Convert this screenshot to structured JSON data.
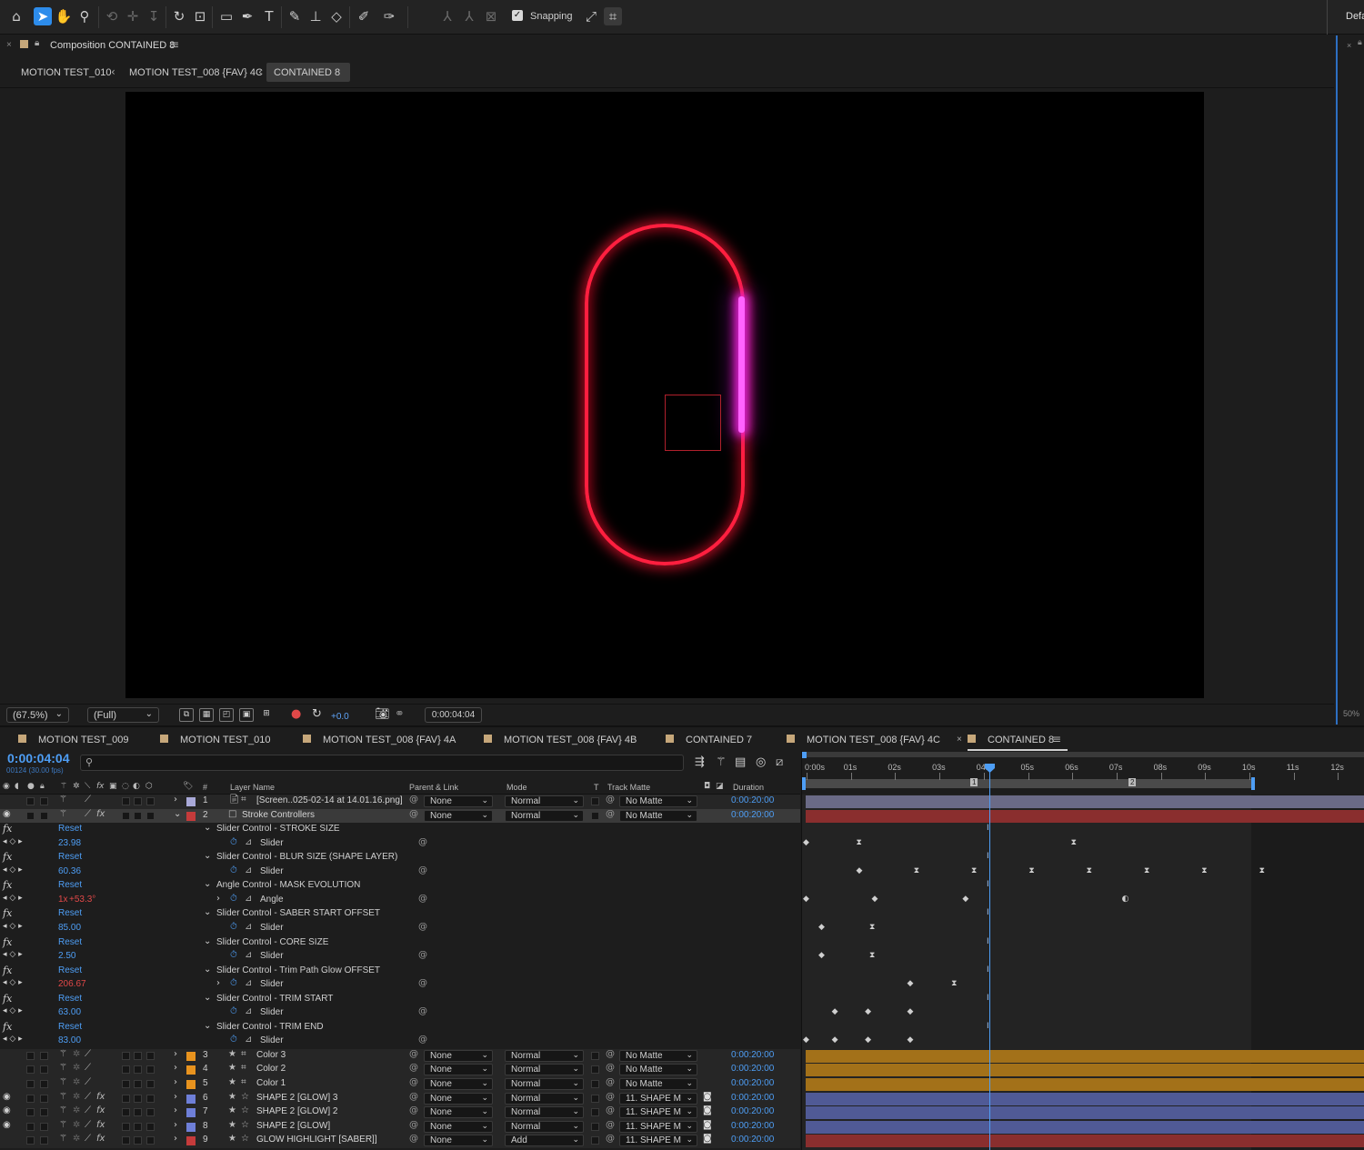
{
  "colors": {
    "accent_blue": "#4e9ef5",
    "label_gray": "#a9a9d8",
    "label_red": "#c53b3b",
    "label_orange": "#e8931e",
    "label_blue": "#6e7fd8",
    "bar_gray": "#6a6a86",
    "bar_red": "#8a2e2e",
    "bar_orange": "#a37119",
    "bar_blue": "#505a96",
    "stroke_red": "#ff1f3f",
    "saber_magenta": "#ff63ff"
  },
  "toolbar": {
    "tools": [
      "home-icon",
      "selection-tool-icon",
      "hand-tool-icon",
      "zoom-tool-icon",
      "orbit-camera-icon",
      "pan-camera-icon",
      "dolly-camera-icon",
      "rotate-tool-icon",
      "pan-behind-tool-icon",
      "rectangle-tool-icon",
      "pen-tool-icon",
      "type-tool-icon",
      "brush-tool-icon",
      "clone-stamp-tool-icon",
      "eraser-tool-icon",
      "roto-brush-tool-icon",
      "puppet-pin-tool-icon"
    ],
    "snapping_label": "Snapping",
    "snapping_checked": true,
    "workspace_label": "Defa"
  },
  "composition": {
    "title": "Composition CONTAINED 8",
    "breadcrumbs": [
      "MOTION TEST_010",
      "MOTION TEST_008 {FAV} 4C",
      "CONTAINED 8"
    ],
    "zoom": "(67.5%)",
    "resolution": "(Full)",
    "exposure": "+0.0",
    "timecode": "0:00:04:04"
  },
  "right_panel": {
    "zoom": "50%"
  },
  "timeline": {
    "tabs": [
      "MOTION TEST_009",
      "MOTION TEST_010",
      "MOTION TEST_008 {FAV} 4A",
      "MOTION TEST_008 {FAV} 4B",
      "CONTAINED 7",
      "MOTION TEST_008 {FAV} 4C",
      "CONTAINED 8"
    ],
    "active_tab": "CONTAINED 8",
    "timecode": "0:00:04:04",
    "frame_info": "00124 (30.00 fps)",
    "search_placeholder": "",
    "columns": {
      "number": "#",
      "layer_name": "Layer Name",
      "parent": "Parent & Link",
      "mode": "Mode",
      "t": "T",
      "track_matte": "Track Matte",
      "duration": "Duration"
    },
    "ruler_labels": [
      "0:00s",
      "01s",
      "02s",
      "03s",
      "04s",
      "05s",
      "06s",
      "07s",
      "08s",
      "09s",
      "10s",
      "11s",
      "12s"
    ],
    "marker_labels": [
      "1",
      "2"
    ],
    "layers_top": [
      {
        "num": "1",
        "name": "[Screen..025-02-14 at 14.01.16.png]",
        "parent": "None",
        "mode": "Normal",
        "matte": "No Matte",
        "duration": "0:00:20:00"
      },
      {
        "num": "2",
        "name": "Stroke Controllers",
        "parent": "None",
        "mode": "Normal",
        "matte": "No Matte",
        "duration": "0:00:20:00"
      }
    ],
    "effects": [
      {
        "name": "Slider Control - STROKE SIZE",
        "reset": "Reset",
        "value": "23.98",
        "prop": "Slider"
      },
      {
        "name": "Slider Control - BLUR SIZE (SHAPE LAYER)",
        "reset": "Reset",
        "value": "60.36",
        "prop": "Slider"
      },
      {
        "name": "Angle Control - MASK EVOLUTION",
        "reset": "Reset",
        "value_rev": "1x",
        "value": "+53.3°",
        "prop": "Angle"
      },
      {
        "name": "Slider Control - SABER START OFFSET",
        "reset": "Reset",
        "value": "85.00",
        "prop": "Slider"
      },
      {
        "name": "Slider Control - CORE SIZE",
        "reset": "Reset",
        "value": "2.50",
        "prop": "Slider"
      },
      {
        "name": "Slider Control - Trim Path Glow OFFSET",
        "reset": "Reset",
        "value": "206.67",
        "prop": "Slider"
      },
      {
        "name": "Slider Control - TRIM START",
        "reset": "Reset",
        "value": "63.00",
        "prop": "Slider"
      },
      {
        "name": "Slider Control - TRIM END",
        "reset": "Reset",
        "value": "83.00",
        "prop": "Slider"
      }
    ],
    "layers_bottom": [
      {
        "num": "3",
        "name": "Color 3",
        "parent": "None",
        "mode": "Normal",
        "matte": "No Matte",
        "duration": "0:00:20:00"
      },
      {
        "num": "4",
        "name": "Color 2",
        "parent": "None",
        "mode": "Normal",
        "matte": "No Matte",
        "duration": "0:00:20:00"
      },
      {
        "num": "5",
        "name": "Color 1",
        "parent": "None",
        "mode": "Normal",
        "matte": "No Matte",
        "duration": "0:00:20:00"
      },
      {
        "num": "6",
        "name": "SHAPE 2 [GLOW] 3",
        "parent": "None",
        "mode": "Normal",
        "matte": "11. SHAPE  M",
        "duration": "0:00:20:00"
      },
      {
        "num": "7",
        "name": "SHAPE 2 [GLOW] 2",
        "parent": "None",
        "mode": "Normal",
        "matte": "11. SHAPE  M",
        "duration": "0:00:20:00"
      },
      {
        "num": "8",
        "name": "SHAPE 2 [GLOW]",
        "parent": "None",
        "mode": "Normal",
        "matte": "11. SHAPE  M",
        "duration": "0:00:20:00"
      },
      {
        "num": "9",
        "name": "GLOW HIGHLIGHT [SABER]]",
        "parent": "None",
        "mode": "Add",
        "matte": "11. SHAPE  M",
        "duration": "0:00:20:00"
      }
    ]
  }
}
